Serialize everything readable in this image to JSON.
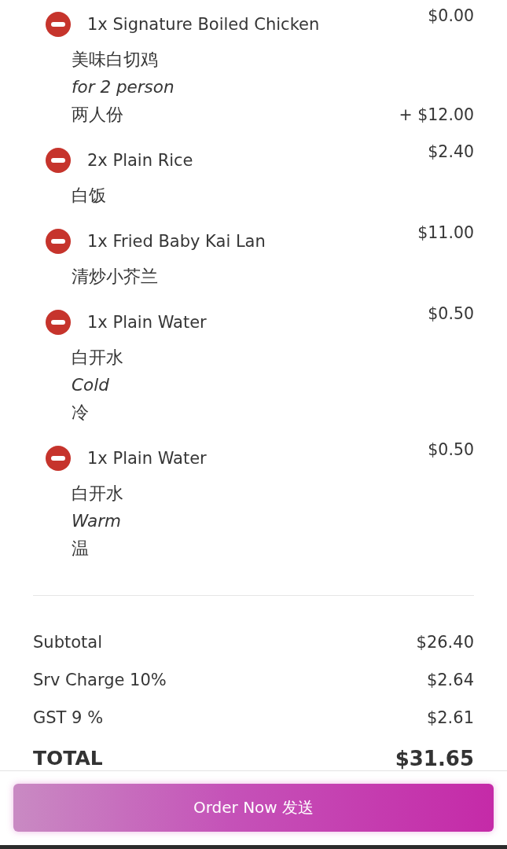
{
  "items": [
    {
      "name": "1x Signature Boiled Chicken",
      "price": "$0.00",
      "details": [
        {
          "kind": "translation",
          "text": "美味白切鸡"
        },
        {
          "kind": "option",
          "text": "for 2 person"
        },
        {
          "kind": "translation",
          "text": "两人份",
          "price": "+ $12.00"
        }
      ]
    },
    {
      "name": "2x Plain Rice",
      "price": "$2.40",
      "details": [
        {
          "kind": "translation",
          "text": "白饭"
        }
      ]
    },
    {
      "name": "1x Fried Baby Kai Lan",
      "price": "$11.00",
      "details": [
        {
          "kind": "translation",
          "text": "清炒小芥兰"
        }
      ]
    },
    {
      "name": "1x Plain Water",
      "price": "$0.50",
      "details": [
        {
          "kind": "translation",
          "text": "白开水"
        },
        {
          "kind": "option",
          "text": "Cold"
        },
        {
          "kind": "translation",
          "text": "冷"
        }
      ]
    },
    {
      "name": "1x Plain Water",
      "price": "$0.50",
      "details": [
        {
          "kind": "translation",
          "text": "白开水"
        },
        {
          "kind": "option",
          "text": "Warm"
        },
        {
          "kind": "translation",
          "text": "温"
        }
      ]
    }
  ],
  "summary": [
    {
      "kind": "line",
      "label": "Subtotal",
      "value": "$26.40"
    },
    {
      "kind": "line",
      "label": "Srv Charge 10%",
      "value": "$2.64"
    },
    {
      "kind": "line",
      "label": "GST 9 %",
      "value": "$2.61"
    },
    {
      "kind": "total",
      "label": "TOTAL",
      "value": "$31.65"
    }
  ],
  "order_button": {
    "label": "Order Now 发送"
  }
}
